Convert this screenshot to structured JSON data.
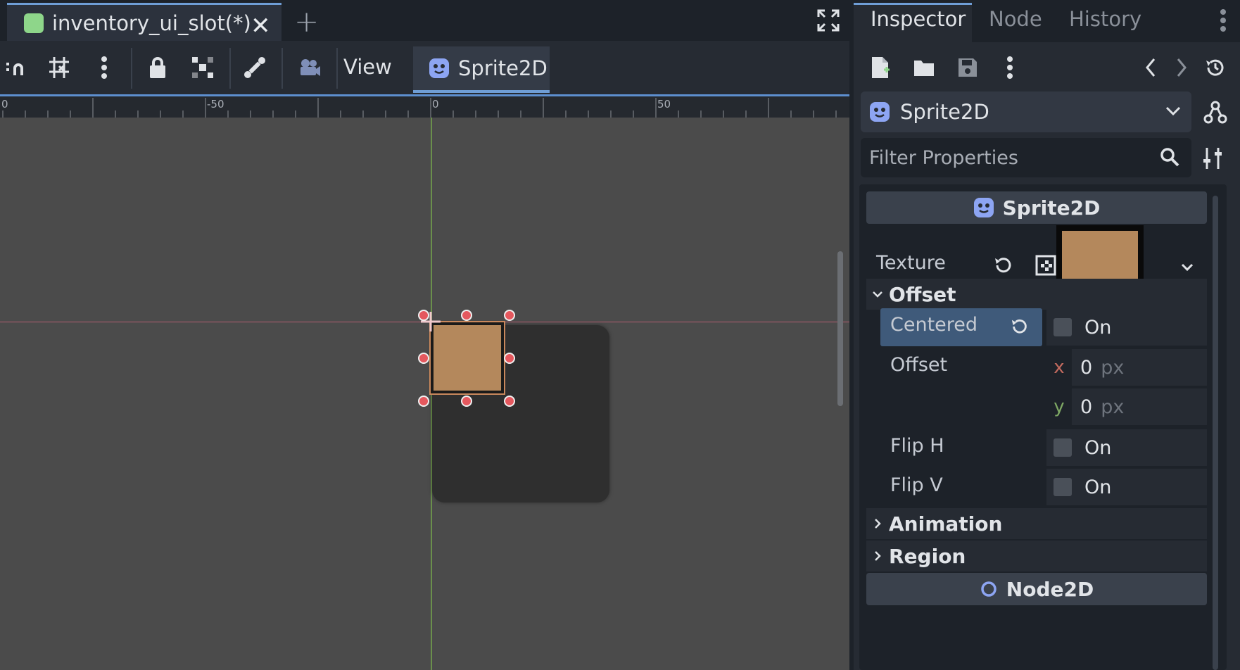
{
  "scene_tabs": {
    "active": "inventory_ui_slot(*)",
    "close_glyph": "✕",
    "add_glyph": "+",
    "scene_icon_color": "#8ed68a"
  },
  "editor_toolbar": {
    "view_menu": "View",
    "context_tab": "Sprite2D",
    "icons": [
      "smart-snap-icon",
      "grid-snap-icon",
      "kebab-menu-icon",
      "lock-icon",
      "group-icon",
      "bone-icon",
      "camera-override-icon"
    ]
  },
  "ruler": {
    "labels": [
      "0",
      "-50",
      "0",
      "50"
    ]
  },
  "colors": {
    "accent": "#6f9ed6",
    "sprite_fill": "#b4885c",
    "handle": "#e5585e",
    "godot_icon": "#8da5f3"
  },
  "inspector": {
    "tabs": [
      "Inspector",
      "Node",
      "History"
    ],
    "object_name": "Sprite2D",
    "filter_placeholder": "Filter Properties",
    "class_header": "Sprite2D",
    "texture_label": "Texture",
    "offset_section": "Offset",
    "properties": {
      "centered_label": "Centered",
      "centered_value": "On",
      "offset_label": "Offset",
      "offset_x_tag": "x",
      "offset_x": "0",
      "offset_y_tag": "y",
      "offset_y": "0",
      "unit": "px",
      "flip_h_label": "Flip H",
      "flip_h_value": "On",
      "flip_v_label": "Flip V",
      "flip_v_value": "On"
    },
    "animation_section": "Animation",
    "region_section": "Region",
    "parent_class_header": "Node2D"
  }
}
